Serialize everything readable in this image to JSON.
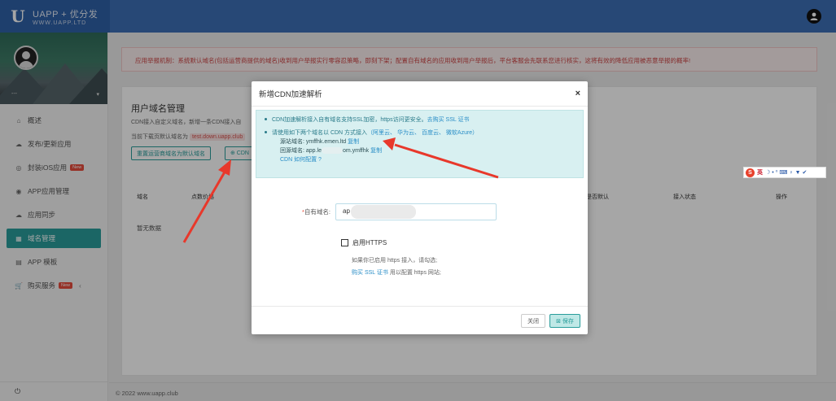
{
  "app": {
    "logo_mark": "U",
    "logo_title": "UAPP + 优分发",
    "logo_sub": "WWW.UAPP.LTD",
    "user_icon": "user-circle-icon"
  },
  "profile": {
    "name": "---",
    "caret": "▾"
  },
  "sidebar": {
    "items": [
      {
        "label": "概述",
        "icon": "⌂",
        "icon_name": "home-icon"
      },
      {
        "label": "发布/更新应用",
        "icon": "☁",
        "icon_name": "cloud-upload-icon"
      },
      {
        "label": "封装iOS应用",
        "icon": "◎",
        "icon_name": "package-icon",
        "badge": "New"
      },
      {
        "label": "APP应用管理",
        "icon": "◉",
        "icon_name": "app-icon"
      },
      {
        "label": "应用同步",
        "icon": "☁",
        "icon_name": "cloud-sync-icon"
      },
      {
        "label": "域名管理",
        "icon": "▦",
        "icon_name": "grid-icon",
        "active": true
      },
      {
        "label": "APP 模板",
        "icon": "▤",
        "icon_name": "template-icon"
      },
      {
        "label": "购买服务",
        "icon": "🛒",
        "icon_name": "cart-icon",
        "badge": "New",
        "chevron": "‹"
      }
    ],
    "footer_icon": "⏻"
  },
  "alert": {
    "text": "应用举报机制：系统默认域名(包括运营商提供的域名)收到用户举报实行零容忍策略，即刻下架；配置自有域名的应用收到用户举报后，平台客服会先联系您进行核实，这将有效的降低应用被恶意举报的概率!"
  },
  "panel": {
    "title": "用户域名管理",
    "desc": "CDN接入自定义域名，新增一条CDN接入自",
    "current_label": "当前下载页默认域名为",
    "current_domain": "test.down.uapp.club",
    "btn_reset": "重置运营商域名为默认域名",
    "btn_cdn": "⊕ CDN",
    "columns": [
      "域名",
      "点数价格",
      "是否默认",
      "接入状态",
      "操作"
    ],
    "no_data": "暂无数据"
  },
  "footer": {
    "copyright": "© 2022 www.uapp.club"
  },
  "modal": {
    "title": "新增CDN加速解析",
    "close": "×",
    "info1_text": "CDN加速解析接入自有域名支持SSL加密，https访问更安全。",
    "info1_link": "去购买 SSL 证书",
    "info2_text": "请使用如下两个域名以 CDN 方式接入",
    "info2_providers": "（阿里云、 华为云、 百度云、 微软Azure）",
    "source_label": "源站域名: ymffhk.emen.ltd",
    "source_copy": "复制",
    "back_label_a": "回源域名: app.le",
    "back_label_b": "om.ymffhk",
    "back_copy": "复制",
    "cdn_howto": "CDN 如何配置 ?",
    "domain_label": "自有域名:",
    "domain_required": "*",
    "domain_value": "ap",
    "https_label": "启用HTTPS",
    "https_note1": "如果你已启用 https 接入，请勾选;",
    "https_note2_link": "购买 SSL 证书",
    "https_note2_text": " 用以配置 https 网站;",
    "btn_close": "关闭",
    "btn_save": "⊠ 保存"
  },
  "ime": {
    "s": "S",
    "lang": "英",
    "icons": "☽ • ⁰ ⌨ ♀ ▼ ✔"
  }
}
